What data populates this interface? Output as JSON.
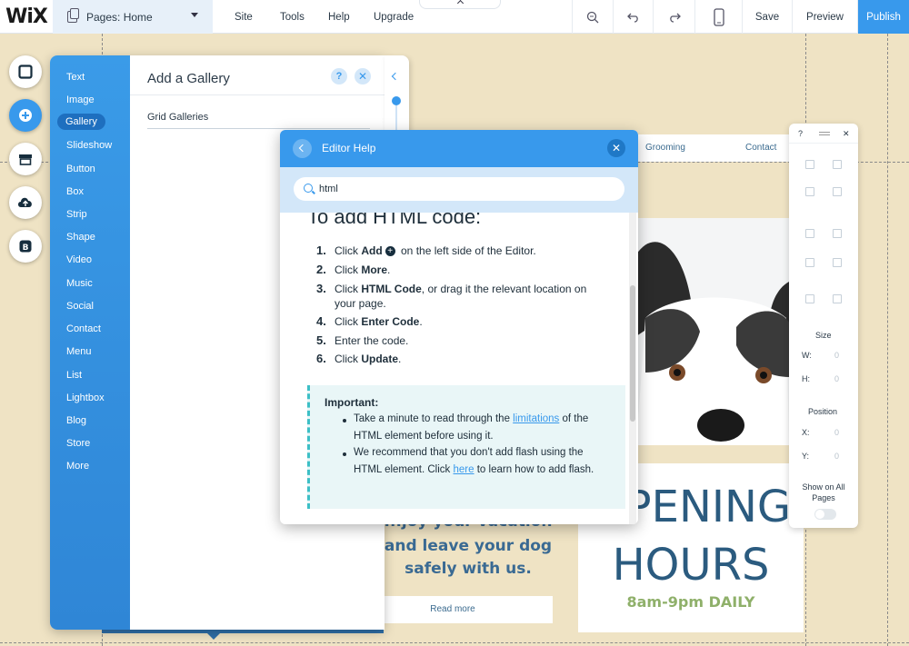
{
  "topbar": {
    "logo": "WiX",
    "pages_select": "Pages: Home",
    "menu": [
      "Site",
      "Tools",
      "Help",
      "Upgrade"
    ],
    "save": "Save",
    "preview": "Preview",
    "publish": "Publish"
  },
  "add_panel": {
    "title": "Add a Gallery",
    "help_glyph": "?",
    "close_glyph": "✕",
    "subsection": "Grid Galleries",
    "categories": [
      "Text",
      "Image",
      "Gallery",
      "Slideshow",
      "Button",
      "Box",
      "Strip",
      "Shape",
      "Video",
      "Music",
      "Social",
      "Contact",
      "Menu",
      "List",
      "Lightbox",
      "Blog",
      "Store",
      "More"
    ],
    "selected_category": "Gallery"
  },
  "help": {
    "title": "Editor Help",
    "close_glyph": "✕",
    "search_value": "html",
    "heading": "To add HTML code:",
    "steps": [
      {
        "num": "1.",
        "pre": "Click ",
        "bold": "Add",
        "post": " on the left side of the Editor."
      },
      {
        "num": "2.",
        "pre": "Click ",
        "bold": "More",
        "post": "."
      },
      {
        "num": "3.",
        "pre": "Click ",
        "bold": "HTML Code",
        "post": ", or drag it the relevant location on"
      },
      {
        "num": "",
        "pre": "your page.",
        "bold": "",
        "post": ""
      },
      {
        "num": "4.",
        "pre": "Click ",
        "bold": "Enter Code",
        "post": "."
      },
      {
        "num": "5.",
        "pre": "Enter the code.",
        "bold": "",
        "post": ""
      },
      {
        "num": "6.",
        "pre": "Click ",
        "bold": "Update",
        "post": "."
      }
    ],
    "important_title": "Important:",
    "important_1_pre": "Take a minute to read through the ",
    "important_1_link": "limitations",
    "important_1_post": " of the HTML element before using it.",
    "important_2_pre": "We recommend that you don't add flash using the HTML element. Click ",
    "important_2_link": "here",
    "important_2_post": " to learn how to add flash."
  },
  "site": {
    "nav": [
      "Grooming",
      "Contact"
    ],
    "vacation_lines": [
      "...joy your vacation",
      "and leave your dog",
      "safely with us."
    ],
    "read_more": "Read more",
    "opening_line1": "OPENING",
    "opening_line2": "HOURS",
    "hours": "8am-9pm DAILY"
  },
  "inspector": {
    "help_glyph": "?",
    "close_glyph": "✕",
    "size_label": "Size",
    "w_label": "W:",
    "h_label": "H:",
    "w_value": "0",
    "h_value": "0",
    "position_label": "Position",
    "x_label": "X:",
    "y_label": "Y:",
    "x_value": "0",
    "y_value": "0",
    "show_all_pages": "Show on All Pages"
  },
  "colors": {
    "accent": "#3899ec",
    "panel_blue": "#2f86d6",
    "canvas": "#efe3c4",
    "site_text": "#2b5b7f",
    "hours_green": "#8fb06a"
  }
}
